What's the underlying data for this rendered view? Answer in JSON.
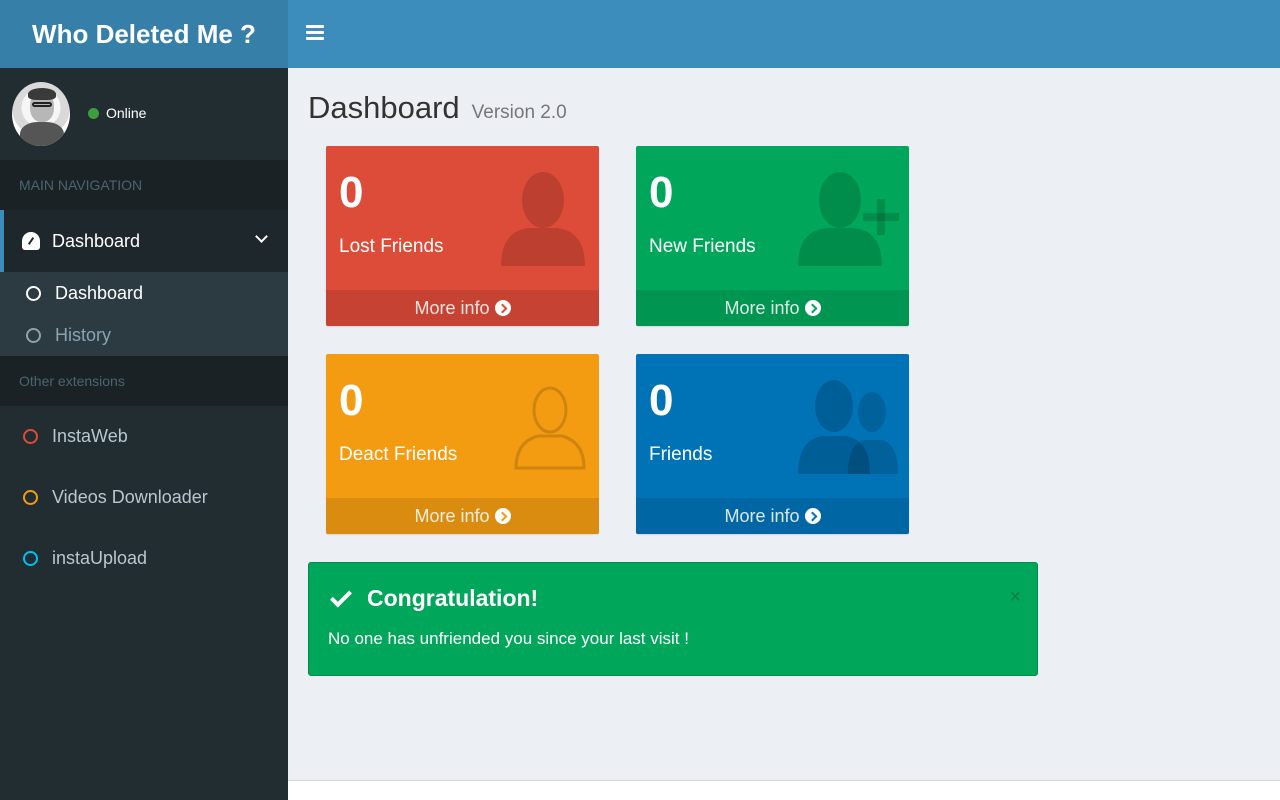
{
  "app": {
    "title": "Who Deleted Me ?"
  },
  "user": {
    "status": "Online"
  },
  "sidebar": {
    "main_nav_header": "MAIN NAVIGATION",
    "dashboard_label": "Dashboard",
    "submenu": [
      {
        "label": "Dashboard"
      },
      {
        "label": "History"
      }
    ],
    "other_header": "Other extensions",
    "extensions": [
      {
        "label": "InstaWeb",
        "color": "#dd4b39"
      },
      {
        "label": "Videos Downloader",
        "color": "#f39c12"
      },
      {
        "label": "instaUpload",
        "color": "#00c0ef"
      }
    ]
  },
  "page": {
    "title": "Dashboard",
    "subtitle": "Version 2.0"
  },
  "stats": [
    {
      "value": "0",
      "label": "Lost Friends",
      "more": "More info",
      "icon": "user-icon",
      "color": "#dd4b39"
    },
    {
      "value": "0",
      "label": "New Friends",
      "more": "More info",
      "icon": "user-plus-icon",
      "color": "#00a65a"
    },
    {
      "value": "0",
      "label": "Deact Friends",
      "more": "More info",
      "icon": "user-outline-icon",
      "color": "#f39c12"
    },
    {
      "value": "0",
      "label": "Friends",
      "more": "More info",
      "icon": "users-icon",
      "color": "#0073b7"
    }
  ],
  "alert": {
    "title": "Congratulation!",
    "message": "No one has unfriended you since your last visit !",
    "close": "×"
  },
  "topbar": {
    "menu_icon": "hamburger-icon"
  }
}
